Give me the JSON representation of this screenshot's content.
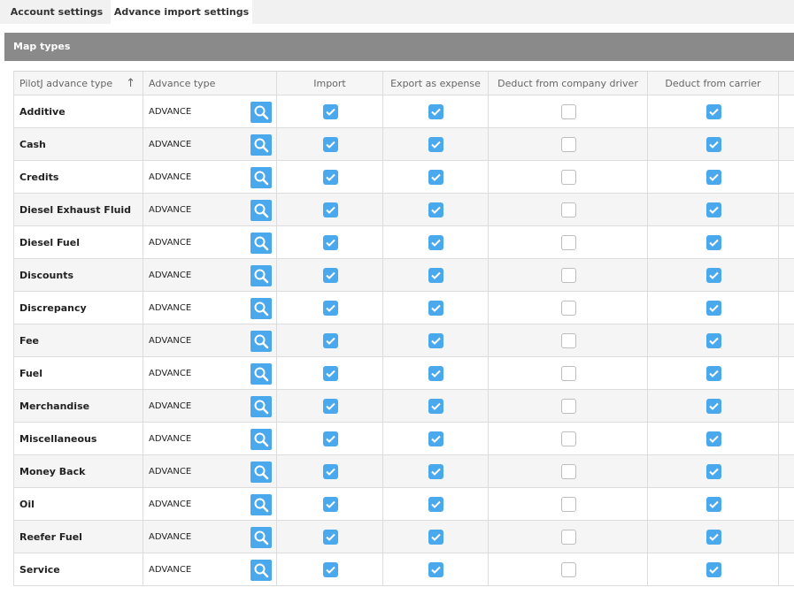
{
  "tabs": [
    {
      "label": "Account settings",
      "active": false
    },
    {
      "label": "Advance import settings",
      "active": true
    }
  ],
  "section": {
    "title": "Map types"
  },
  "table": {
    "headers": {
      "name": "PilotJ advance type",
      "advance_type": "Advance type",
      "import": "Import",
      "export_expense": "Export as expense",
      "deduct_driver": "Deduct from company driver",
      "deduct_carrier": "Deduct from carrier"
    },
    "sort_icon": "up-arrow",
    "rows": [
      {
        "name": "Additive",
        "type": "ADVANCE",
        "import": true,
        "export": true,
        "driver": false,
        "carrier": true
      },
      {
        "name": "Cash",
        "type": "ADVANCE",
        "import": true,
        "export": true,
        "driver": false,
        "carrier": true
      },
      {
        "name": "Credits",
        "type": "ADVANCE",
        "import": true,
        "export": true,
        "driver": false,
        "carrier": true
      },
      {
        "name": "Diesel Exhaust Fluid",
        "type": "ADVANCE",
        "import": true,
        "export": true,
        "driver": false,
        "carrier": true
      },
      {
        "name": "Diesel Fuel",
        "type": "ADVANCE",
        "import": true,
        "export": true,
        "driver": false,
        "carrier": true
      },
      {
        "name": "Discounts",
        "type": "ADVANCE",
        "import": true,
        "export": true,
        "driver": false,
        "carrier": true
      },
      {
        "name": "Discrepancy",
        "type": "ADVANCE",
        "import": true,
        "export": true,
        "driver": false,
        "carrier": true
      },
      {
        "name": "Fee",
        "type": "ADVANCE",
        "import": true,
        "export": true,
        "driver": false,
        "carrier": true
      },
      {
        "name": "Fuel",
        "type": "ADVANCE",
        "import": true,
        "export": true,
        "driver": false,
        "carrier": true
      },
      {
        "name": "Merchandise",
        "type": "ADVANCE",
        "import": true,
        "export": true,
        "driver": false,
        "carrier": true
      },
      {
        "name": "Miscellaneous",
        "type": "ADVANCE",
        "import": true,
        "export": true,
        "driver": false,
        "carrier": true
      },
      {
        "name": "Money Back",
        "type": "ADVANCE",
        "import": true,
        "export": true,
        "driver": false,
        "carrier": true
      },
      {
        "name": "Oil",
        "type": "ADVANCE",
        "import": true,
        "export": true,
        "driver": false,
        "carrier": true
      },
      {
        "name": "Reefer Fuel",
        "type": "ADVANCE",
        "import": true,
        "export": true,
        "driver": false,
        "carrier": true
      },
      {
        "name": "Service",
        "type": "ADVANCE",
        "import": true,
        "export": true,
        "driver": false,
        "carrier": true
      }
    ]
  },
  "colors": {
    "accent": "#4aa8ec",
    "section_header": "#8a8a8a"
  }
}
